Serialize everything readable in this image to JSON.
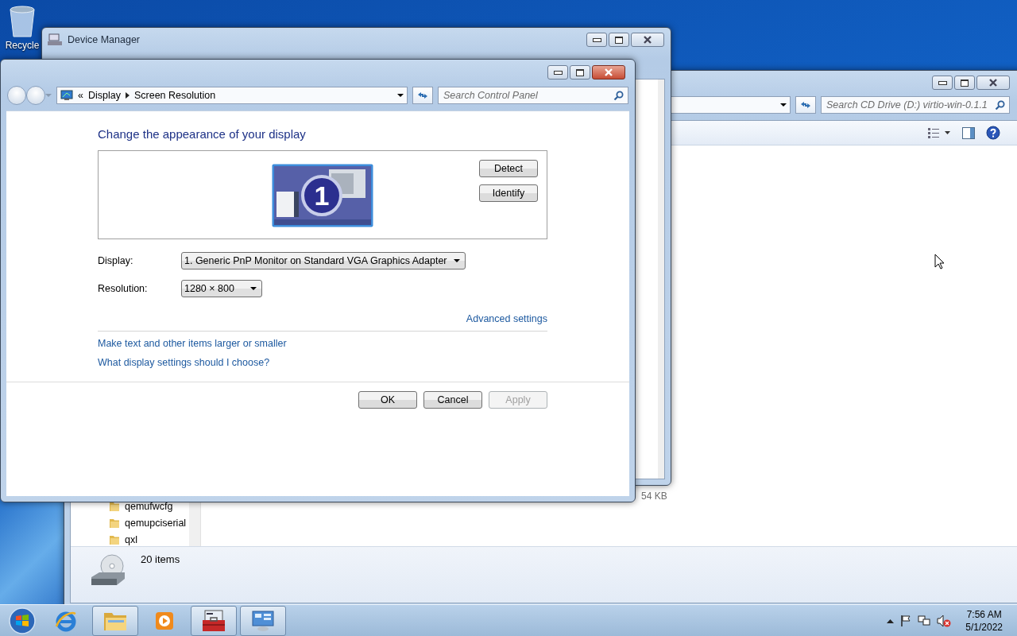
{
  "desktop": {
    "icons": [
      {
        "label": "Recycle"
      }
    ]
  },
  "explorer": {
    "search": {
      "placeholder": "Search CD Drive (D:) virtio-win-0.1.1"
    },
    "nav_items": [
      {
        "label": "qemufwcfg"
      },
      {
        "label": "qemupciserial"
      },
      {
        "label": "qxl"
      }
    ],
    "size_text": "54 KB",
    "status": "20 items"
  },
  "device_manager": {
    "title": "Device Manager"
  },
  "dialog": {
    "breadcrumb_overflow": "«",
    "breadcrumb": [
      "Display",
      "Screen Resolution"
    ],
    "search": {
      "placeholder": "Search Control Panel"
    },
    "heading": "Change the appearance of your display",
    "monitor_number": "1",
    "side_buttons": [
      "Detect",
      "Identify"
    ],
    "fields": [
      {
        "label": "Display:",
        "value": "1. Generic PnP Monitor on Standard VGA Graphics Adapter"
      },
      {
        "label": "Resolution:",
        "value": "1280 × 800"
      }
    ],
    "advanced_link": "Advanced settings",
    "links": [
      "Make text and other items larger or smaller",
      "What display settings should I choose?"
    ],
    "buttons": [
      {
        "label": "OK",
        "disabled": false
      },
      {
        "label": "Cancel",
        "disabled": false
      },
      {
        "label": "Apply",
        "disabled": true
      }
    ]
  },
  "taskbar": {
    "apps": [
      {
        "kind": "browser",
        "running": false
      },
      {
        "kind": "folder",
        "running": true
      },
      {
        "kind": "media",
        "running": false
      },
      {
        "kind": "toolbox",
        "running": true
      },
      {
        "kind": "control-panel",
        "running": true
      }
    ],
    "clock": {
      "time": "7:56 AM",
      "date": "5/1/2022"
    }
  }
}
